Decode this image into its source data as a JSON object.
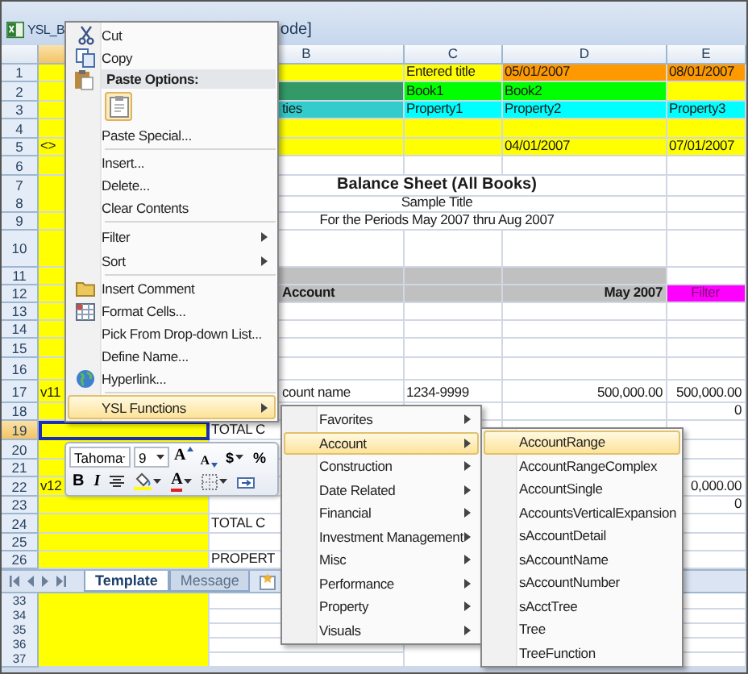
{
  "window": {
    "title_parts": [
      "YSL_B",
      "ode]"
    ]
  },
  "columns": [
    {
      "color": "#ffff00"
    },
    {
      "label": "B"
    },
    {
      "label": "C"
    },
    {
      "label": "D"
    },
    {
      "label": "E"
    }
  ],
  "rows": [
    {
      "number": "1",
      "cells": [
        {
          "kind": "blank",
          "selected": false
        },
        {
          "kind": "fill",
          "color": "#ffff00",
          "selected": false
        },
        {
          "kind": "text",
          "text": "Entered title",
          "color": "#ffff00",
          "selected": false
        },
        {
          "kind": "text",
          "text": "05/01/2007",
          "color": "#ff9900",
          "selected": false
        },
        {
          "kind": "text",
          "text": "08/01/2007",
          "color": "#ff9900",
          "selected": false
        }
      ]
    },
    {
      "number": "2",
      "cells": [
        {
          "kind": "blank",
          "selected": false
        },
        {
          "kind": "fill",
          "color": "#339966",
          "selected": false
        },
        {
          "kind": "text",
          "text": "Book1",
          "color": "#00ff00",
          "selected": false
        },
        {
          "kind": "text",
          "text": "Book2",
          "color": "#00ff00",
          "selected": false
        },
        {
          "kind": "fill",
          "color": "#ffff00",
          "selected": false
        }
      ]
    },
    {
      "number": "3",
      "cells": [
        {
          "kind": "blank",
          "selected": false
        },
        {
          "kind": "tail",
          "text": "ties",
          "color": "#33cccc",
          "selected": false
        },
        {
          "kind": "text",
          "text": "Property1",
          "color": "#00ffff",
          "selected": false
        },
        {
          "kind": "text",
          "text": "Property2",
          "color": "#00ffff",
          "selected": false
        },
        {
          "kind": "text",
          "text": "Property3",
          "color": "#00ffff",
          "selected": false
        }
      ]
    },
    {
      "number": "4",
      "cells": [
        {
          "kind": "blank",
          "selected": false
        },
        {
          "kind": "fill",
          "color": "#ffff00",
          "selected": false
        },
        {
          "kind": "fill",
          "color": "#ffff00",
          "selected": false
        },
        {
          "kind": "fill",
          "color": "#ffff00",
          "selected": false
        },
        {
          "kind": "fill",
          "color": "#ffff00",
          "selected": false
        }
      ]
    },
    {
      "number": "5",
      "cells": [
        {
          "kind": "text",
          "text": "<>",
          "selected": false
        },
        {
          "kind": "fill",
          "color": "#ffff00",
          "selected": false
        },
        {
          "kind": "fill",
          "color": "#ffff00",
          "selected": false
        },
        {
          "kind": "text",
          "text": "04/01/2007",
          "color": "#ffff00",
          "selected": false
        },
        {
          "kind": "text",
          "text": "07/01/2007",
          "color": "#ffff00",
          "selected": false
        }
      ]
    },
    {
      "number": "6"
    },
    {
      "number": "7",
      "cells": [
        {
          "kind": "blank",
          "selected": false
        },
        {
          "kind": "title",
          "text": "Balance Sheet (All Books)",
          "selected": false
        }
      ]
    },
    {
      "number": "8",
      "cells": [
        {
          "kind": "blank",
          "selected": false
        },
        {
          "kind": "caption",
          "text": "Sample Title",
          "selected": false
        }
      ]
    },
    {
      "number": "9",
      "cells": [
        {
          "kind": "blank",
          "selected": false
        },
        {
          "kind": "caption",
          "text": "For the Periods May 2007 thru Aug 2007",
          "selected": false
        }
      ]
    },
    {
      "number": "10"
    },
    {
      "number": "11",
      "cells": [
        {
          "kind": "blank",
          "selected": false
        },
        {
          "kind": "fill",
          "color": "#c0c0c0",
          "selected": false
        },
        {
          "kind": "fill",
          "color": "#c0c0c0",
          "selected": false
        },
        {
          "kind": "fill",
          "color": "#c0c0c0",
          "selected": false
        }
      ]
    },
    {
      "number": "12",
      "cells": [
        {
          "kind": "blank",
          "selected": false
        },
        {
          "kind": "heading",
          "text": "Account",
          "color": "#c0c0c0",
          "selected": false
        },
        {
          "kind": "fill",
          "color": "#c0c0c0",
          "selected": false
        },
        {
          "kind": "heading-number",
          "text": "May 2007",
          "color": "#c0c0c0",
          "selected": false
        },
        {
          "kind": "tag",
          "text": "Filter",
          "color": "#ff00ff",
          "selected": false
        }
      ]
    },
    {
      "number": "13"
    },
    {
      "number": "14"
    },
    {
      "number": "15"
    },
    {
      "number": "16"
    },
    {
      "number": "17",
      "cells": [
        {
          "kind": "text",
          "text": "v11",
          "selected": false
        },
        {
          "kind": "tail",
          "text": "count name",
          "selected": false
        },
        {
          "kind": "text",
          "text": "1234-9999",
          "selected": false
        },
        {
          "kind": "number",
          "text": "500,000.00",
          "selected": false
        },
        {
          "kind": "number",
          "text": "500,000.00",
          "selected": false
        }
      ]
    },
    {
      "number": "18",
      "cells": [
        {
          "kind": "blank",
          "selected": false
        },
        {
          "kind": "blank",
          "selected": false
        },
        {
          "kind": "blank",
          "selected": false
        },
        {
          "kind": "blank",
          "selected": false
        },
        {
          "kind": "number",
          "text": "0",
          "selected": false
        }
      ]
    },
    {
      "number": "19",
      "cells": [
        {
          "kind": "blank",
          "selected": true
        },
        {
          "kind": "text",
          "text": "TOTAL C",
          "selected": false
        }
      ]
    },
    {
      "number": "20"
    },
    {
      "number": "21"
    },
    {
      "number": "22",
      "cells": [
        {
          "kind": "text",
          "text": "v12",
          "selected": false
        },
        {
          "kind": "blank",
          "selected": false
        },
        {
          "kind": "blank"
        },
        {
          "kind": "blank"
        },
        {
          "kind": "number",
          "text": "0,000.00",
          "selected": false
        }
      ]
    },
    {
      "number": "23",
      "cells": [
        {
          "kind": "blank",
          "selected": false
        },
        {
          "kind": "blank",
          "selected": false
        },
        {
          "kind": "blank"
        },
        {
          "kind": "blank"
        },
        {
          "kind": "number",
          "text": "0",
          "selected": false
        }
      ]
    },
    {
      "number": "24",
      "cells": [
        {
          "kind": "blank",
          "selected": false
        },
        {
          "kind": "text",
          "text": "TOTAL C",
          "selected": false
        }
      ]
    },
    {
      "number": "25"
    },
    {
      "number": "26",
      "cells": [
        {
          "kind": "blank",
          "selected": false
        },
        {
          "kind": "text",
          "text": "PROPERT",
          "selected": false
        }
      ]
    }
  ],
  "sheet_tabs": [
    {
      "label": "Template",
      "selected": true
    },
    {
      "label": "Message",
      "selected": false
    }
  ],
  "lower_pane_rows": [
    {
      "number": "33"
    },
    {
      "number": "34"
    },
    {
      "number": "35"
    },
    {
      "number": "36"
    },
    {
      "number": "37"
    }
  ],
  "context_menu": [
    {
      "kind": "command",
      "label": "Cut",
      "selected": false
    },
    {
      "kind": "command",
      "label": "Copy",
      "selected": false
    },
    {
      "kind": "header",
      "label": "Paste Options:"
    },
    {
      "kind": "paste-options"
    },
    {
      "kind": "command",
      "label": "Paste Special...",
      "selected": false
    },
    {
      "kind": "separator"
    },
    {
      "kind": "command",
      "label": "Insert...",
      "selected": false
    },
    {
      "kind": "command",
      "label": "Delete...",
      "selected": false
    },
    {
      "kind": "command",
      "label": "Clear Contents",
      "selected": false
    },
    {
      "kind": "separator"
    },
    {
      "kind": "submenu",
      "label": "Filter",
      "selected": false
    },
    {
      "kind": "submenu",
      "label": "Sort",
      "selected": false
    },
    {
      "kind": "separator"
    },
    {
      "kind": "command",
      "label": "Insert Comment",
      "selected": false
    },
    {
      "kind": "command",
      "label": "Format Cells...",
      "selected": false
    },
    {
      "kind": "command",
      "label": "Pick From Drop-down List...",
      "selected": false
    },
    {
      "kind": "command",
      "label": "Define Name...",
      "selected": false
    },
    {
      "kind": "command",
      "label": "Hyperlink...",
      "selected": false
    },
    {
      "kind": "separator"
    },
    {
      "kind": "submenu",
      "label": "YSL Functions",
      "selected": true
    }
  ],
  "mini_toolbar": {
    "font": "Tahoma",
    "size": "9",
    "row1": [
      {
        "kind": "grow-font",
        "label": "A"
      },
      {
        "kind": "shrink-font",
        "label": "A"
      },
      {
        "kind": "currency",
        "label": "$"
      },
      {
        "kind": "percent",
        "label": "%"
      }
    ],
    "row2": [
      {
        "kind": "bold",
        "label": "B"
      },
      {
        "kind": "italic",
        "label": "I"
      },
      {
        "kind": "center"
      },
      {
        "kind": "fill-color"
      },
      {
        "kind": "font-color",
        "label": "A"
      },
      {
        "kind": "borders"
      },
      {
        "kind": "merge"
      }
    ]
  },
  "ysl_submenu": [
    {
      "label": "Favorites",
      "selected": false
    },
    {
      "label": "Account",
      "selected": true
    },
    {
      "label": "Construction",
      "selected": false
    },
    {
      "label": "Date Related",
      "selected": false
    },
    {
      "label": "Financial",
      "selected": false
    },
    {
      "label": "Investment Management",
      "selected": false
    },
    {
      "label": "Misc",
      "selected": false
    },
    {
      "label": "Performance",
      "selected": false
    },
    {
      "label": "Property",
      "selected": false
    },
    {
      "label": "Visuals",
      "selected": false
    }
  ],
  "account_submenu": [
    {
      "label": "AccountRange",
      "selected": true
    },
    {
      "label": "AccountRangeComplex",
      "selected": false
    },
    {
      "label": "AccountSingle",
      "selected": false
    },
    {
      "label": "AccountsVerticalExpansion",
      "selected": false
    },
    {
      "label": "sAccountDetail",
      "selected": false
    },
    {
      "label": "sAccountName",
      "selected": false
    },
    {
      "label": "sAccountNumber",
      "selected": false
    },
    {
      "label": "sAcctTree",
      "selected": false
    },
    {
      "label": "Tree",
      "selected": false
    },
    {
      "label": "TreeFunction",
      "selected": false
    }
  ]
}
